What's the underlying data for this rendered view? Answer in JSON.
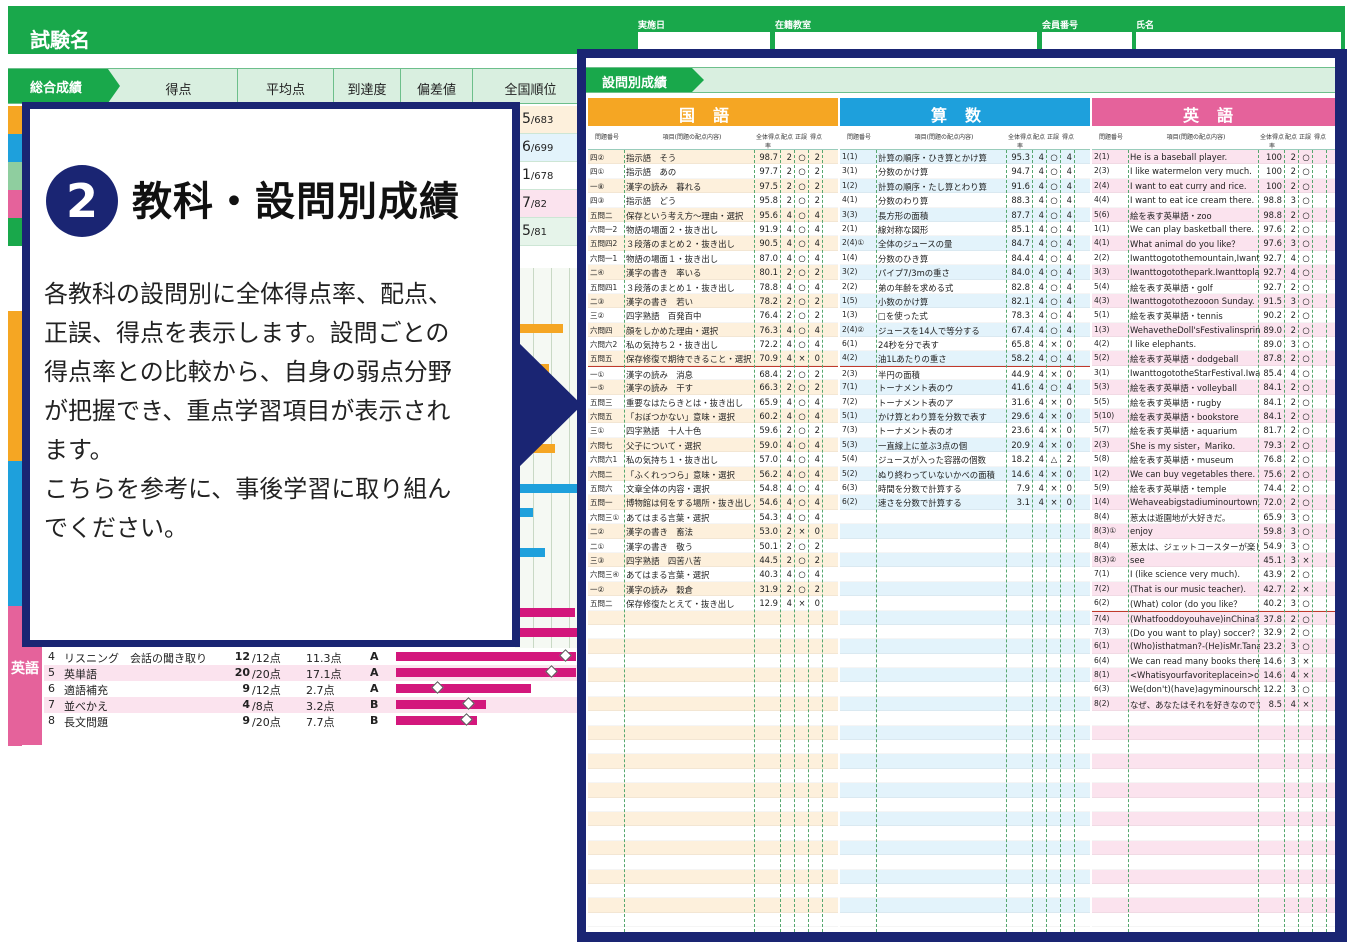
{
  "sheet": {
    "title": "試験名",
    "header_fields": [
      "実施日",
      "在籍教室",
      "会員番号",
      "氏名"
    ],
    "summary_tag": "総合成績",
    "summary_columns": [
      "得点",
      "平均点",
      "到達度",
      "偏差値",
      "全国順位"
    ],
    "ranks": [
      {
        "rank": "5",
        "total": "/683"
      },
      {
        "rank": "6",
        "total": "/699"
      },
      {
        "rank": "1",
        "total": "/678"
      },
      {
        "rank": "7",
        "total": "/82"
      },
      {
        "rank": "5",
        "total": "/81"
      }
    ],
    "english_label": "英語",
    "english_rows": [
      {
        "no": "4",
        "name": "リスニング　会話の聞き取り",
        "score": "12",
        "max": "/12点",
        "avg": "11.3点",
        "grade": "A",
        "bar": 1.0,
        "avg_frac": 0.94
      },
      {
        "no": "5",
        "name": "英単語",
        "score": "20",
        "max": "/20点",
        "avg": "17.1点",
        "grade": "A",
        "bar": 1.0,
        "avg_frac": 0.86
      },
      {
        "no": "6",
        "name": "適語補充",
        "score": "9",
        "max": "/12点",
        "avg": "2.7点",
        "grade": "A",
        "bar": 0.75,
        "avg_frac": 0.23
      },
      {
        "no": "7",
        "name": "並べかえ",
        "score": "4",
        "max": "/8点",
        "avg": "3.2点",
        "grade": "B",
        "bar": 0.5,
        "avg_frac": 0.4
      },
      {
        "no": "8",
        "name": "長文問題",
        "score": "9",
        "max": "/20点",
        "avg": "7.7点",
        "grade": "B",
        "bar": 0.45,
        "avg_frac": 0.39
      }
    ]
  },
  "popup": {
    "number": "2",
    "title": "教科・設問別成績",
    "body": [
      "各教科の設問別に全体得点率、配点、",
      "正誤、得点を表示します。設問ごとの",
      "得点率との比較から、自身の弱点分野",
      "が把握でき、重点学習項目が表示され",
      "ます。",
      "こちらを参考に、事後学習に取り組ん",
      "でください。"
    ]
  },
  "detail": {
    "tag": "設問別成績",
    "col_heads": [
      "問題番号",
      "項目(問題の配点内容)",
      "全体得点率",
      "配点",
      "正誤",
      "得点"
    ],
    "subjects": [
      {
        "name": "国語",
        "color": "#f5a623",
        "stripe": "#fdf0dc",
        "sep_after": 14,
        "rows": [
          [
            "四②",
            "指示語　そう",
            "98.7",
            "2",
            "○",
            "2"
          ],
          [
            "四①",
            "指示語　あの",
            "97.7",
            "2",
            "○",
            "2"
          ],
          [
            "一⑧",
            "漢字の読み　暮れる",
            "97.5",
            "2",
            "○",
            "2"
          ],
          [
            "四③",
            "指示語　どう",
            "95.8",
            "2",
            "○",
            "2"
          ],
          [
            "五問二",
            "保存という考え方～理由・選択",
            "95.6",
            "4",
            "○",
            "4"
          ],
          [
            "六問一2",
            "物語の場面２・抜き出し",
            "91.9",
            "4",
            "○",
            "4"
          ],
          [
            "五問四2",
            "３段落のまとめ２・抜き出し",
            "90.5",
            "4",
            "○",
            "4"
          ],
          [
            "六問一1",
            "物語の場面１・抜き出し",
            "87.0",
            "4",
            "○",
            "4"
          ],
          [
            "二④",
            "漢字の書き　率いる",
            "80.1",
            "2",
            "○",
            "2"
          ],
          [
            "五問四1",
            "３段落のまとめ１・抜き出し",
            "78.8",
            "4",
            "○",
            "4"
          ],
          [
            "二③",
            "漢字の書き　若い",
            "78.2",
            "2",
            "○",
            "2"
          ],
          [
            "三②",
            "四字熟語　百発百中",
            "76.4",
            "2",
            "○",
            "2"
          ],
          [
            "六問四",
            "顔をしかめた理由・選択",
            "76.3",
            "4",
            "○",
            "4"
          ],
          [
            "六問六2",
            "私の気持ち２・抜き出し",
            "72.2",
            "4",
            "○",
            "4"
          ],
          [
            "五問五",
            "保存修復で期待できること・選択",
            "70.9",
            "4",
            "×",
            "0"
          ],
          [
            "一①",
            "漢字の読み　消息",
            "68.4",
            "2",
            "○",
            "2"
          ],
          [
            "一⑤",
            "漢字の読み　干す",
            "66.3",
            "2",
            "○",
            "2"
          ],
          [
            "五問三",
            "重要なはたらきとは・抜き出し",
            "65.9",
            "4",
            "○",
            "4"
          ],
          [
            "六問五",
            "「おぼつかない」意味・選択",
            "60.2",
            "4",
            "○",
            "4"
          ],
          [
            "三①",
            "四字熟語　十人十色",
            "59.6",
            "2",
            "○",
            "2"
          ],
          [
            "六問七",
            "父子について・選択",
            "59.0",
            "4",
            "○",
            "4"
          ],
          [
            "六問六1",
            "私の気持ち１・抜き出し",
            "57.0",
            "4",
            "○",
            "4"
          ],
          [
            "六問二",
            "「ふくれっつら」意味・選択",
            "56.2",
            "4",
            "○",
            "4"
          ],
          [
            "五問六",
            "文章全体の内容・選択",
            "54.8",
            "4",
            "○",
            "4"
          ],
          [
            "五問一",
            "博物館は何をする場所・抜き出し",
            "54.6",
            "4",
            "○",
            "4"
          ],
          [
            "六問三①",
            "あてはまる言葉・選択",
            "54.3",
            "4",
            "○",
            "4"
          ],
          [
            "二②",
            "漢字の書き　畜法",
            "53.0",
            "2",
            "×",
            "0"
          ],
          [
            "二①",
            "漢字の書き　敬う",
            "50.1",
            "2",
            "○",
            "2"
          ],
          [
            "三③",
            "四字熟語　四苦八苦",
            "44.5",
            "2",
            "○",
            "2"
          ],
          [
            "六問三④",
            "あてはまる言葉・選択",
            "40.3",
            "4",
            "○",
            "4"
          ],
          [
            "一②",
            "漢字の読み　穀倉",
            "31.9",
            "2",
            "○",
            "2"
          ],
          [
            "五問二",
            "保存修復たとえて・抜き出し",
            "12.9",
            "4",
            "×",
            "0"
          ]
        ]
      },
      {
        "name": "算数",
        "color": "#1ea0dc",
        "stripe": "#e3f3fb",
        "sep_after": 14,
        "rows": [
          [
            "1(1)",
            "計算の順序・ひき算とかけ算",
            "95.3",
            "4",
            "○",
            "4"
          ],
          [
            "3(1)",
            "分数のかけ算",
            "94.7",
            "4",
            "○",
            "4"
          ],
          [
            "1(2)",
            "計算の順序・たし算とわり算",
            "91.6",
            "4",
            "○",
            "4"
          ],
          [
            "4(1)",
            "分数のわり算",
            "88.3",
            "4",
            "○",
            "4"
          ],
          [
            "3(3)",
            "長方形の面積",
            "87.7",
            "4",
            "○",
            "4"
          ],
          [
            "2(1)",
            "線対称な図形",
            "85.1",
            "4",
            "○",
            "4"
          ],
          [
            "2(4)①",
            "全体のジュースの量",
            "84.7",
            "4",
            "○",
            "4"
          ],
          [
            "1(4)",
            "分数のひき算",
            "84.4",
            "4",
            "○",
            "4"
          ],
          [
            "3(2)",
            "パイプ7/3mの重さ",
            "84.0",
            "4",
            "○",
            "4"
          ],
          [
            "2(2)",
            "弟の年齢を求める式",
            "82.8",
            "4",
            "○",
            "4"
          ],
          [
            "1(5)",
            "小数のかけ算",
            "82.1",
            "4",
            "○",
            "4"
          ],
          [
            "1(3)",
            "□を使った式",
            "78.3",
            "4",
            "○",
            "4"
          ],
          [
            "2(4)②",
            "ジュースを14人で等分する",
            "67.4",
            "4",
            "○",
            "4"
          ],
          [
            "6(1)",
            "24秒を分で表す",
            "65.8",
            "4",
            "×",
            "0"
          ],
          [
            "4(2)",
            "油1Lあたりの重さ",
            "58.2",
            "4",
            "○",
            "4"
          ],
          [
            "2(3)",
            "半円の面積",
            "44.9",
            "4",
            "×",
            "0"
          ],
          [
            "7(1)",
            "トーナメント表のウ",
            "41.6",
            "4",
            "○",
            "4"
          ],
          [
            "7(2)",
            "トーナメント表のア",
            "31.6",
            "4",
            "×",
            "0"
          ],
          [
            "5(1)",
            "かけ算とわり算を分数で表す",
            "29.6",
            "4",
            "×",
            "0"
          ],
          [
            "7(3)",
            "トーナメント表のオ",
            "23.6",
            "4",
            "×",
            "0"
          ],
          [
            "5(3)",
            "一直線上に並ぶ3点の個",
            "20.9",
            "4",
            "×",
            "0"
          ],
          [
            "5(4)",
            "ジュースが入った容器の個数",
            "18.2",
            "4",
            "△",
            "2"
          ],
          [
            "5(2)",
            "ぬり終わっていないかべの面積",
            "14.6",
            "4",
            "×",
            "0"
          ],
          [
            "6(3)",
            "時間を分数で計算する",
            "7.9",
            "4",
            "×",
            "0"
          ],
          [
            "6(2)",
            "速さを分数で計算する",
            "3.1",
            "4",
            "×",
            "0"
          ]
        ]
      },
      {
        "name": "英語",
        "color": "#e5629b",
        "stripe": "#fbe3ee",
        "sep_after": 31,
        "rows": [
          [
            "2(1)",
            "He is a baseball player.",
            "100",
            "2",
            "○",
            ""
          ],
          [
            "2(3)",
            "I like watermelon very much.",
            "100",
            "2",
            "○",
            ""
          ],
          [
            "2(4)",
            "I want to eat curry and rice.",
            "100",
            "2",
            "○",
            ""
          ],
          [
            "4(4)",
            "I want to eat ice cream there.",
            "98.8",
            "3",
            "○",
            ""
          ],
          [
            "5(6)",
            "絵を表す英単語・zoo",
            "98.8",
            "2",
            "○",
            ""
          ],
          [
            "1(1)",
            "We can play basketball there.",
            "97.6",
            "2",
            "○",
            ""
          ],
          [
            "4(1)",
            "What animal do you like？",
            "97.6",
            "3",
            "○",
            ""
          ],
          [
            "2(2)",
            "Iwanttogotothemountain,Iwanttoenjoycamping.",
            "92.7",
            "4",
            "○",
            ""
          ],
          [
            "3(3)",
            "Iwanttogotothepark.Iwanttoplaybadminton.",
            "92.7",
            "4",
            "○",
            ""
          ],
          [
            "5(4)",
            "絵を表す英単語・golf",
            "92.7",
            "2",
            "○",
            ""
          ],
          [
            "4(3)",
            "Iwanttogotothezooon Sunday.",
            "91.5",
            "3",
            "○",
            ""
          ],
          [
            "5(1)",
            "絵を表す英単語・tennis",
            "90.2",
            "2",
            "○",
            ""
          ],
          [
            "1(3)",
            "WehavetheDoll'sFestivalinspring.",
            "89.0",
            "2",
            "○",
            ""
          ],
          [
            "4(2)",
            "I like elephants.",
            "89.0",
            "3",
            "○",
            ""
          ],
          [
            "5(2)",
            "絵を表す英単語・dodgeball",
            "87.8",
            "2",
            "○",
            ""
          ],
          [
            "3(1)",
            "IwanttogototheStarFestival.IwanttoseetheMilkyWay.",
            "85.4",
            "4",
            "○",
            ""
          ],
          [
            "5(3)",
            "絵を表す英単語・volleyball",
            "84.1",
            "2",
            "○",
            ""
          ],
          [
            "5(5)",
            "絵を表す英単語・rugby",
            "84.1",
            "2",
            "○",
            ""
          ],
          [
            "5(10)",
            "絵を表す英単語・bookstore",
            "84.1",
            "2",
            "○",
            ""
          ],
          [
            "5(7)",
            "絵を表す英単語・aquarium",
            "81.7",
            "2",
            "○",
            ""
          ],
          [
            "2(3)",
            "She is my sister，Mariko.",
            "79.3",
            "2",
            "○",
            ""
          ],
          [
            "5(8)",
            "絵を表す英単語・museum",
            "76.8",
            "2",
            "○",
            ""
          ],
          [
            "1(2)",
            "We can buy vegetables there.",
            "75.6",
            "2",
            "○",
            ""
          ],
          [
            "5(9)",
            "絵を表す英単語・temple",
            "74.4",
            "2",
            "○",
            ""
          ],
          [
            "1(4)",
            "Wehaveabigstadiuminourtown.",
            "72.0",
            "2",
            "○",
            ""
          ],
          [
            "8(4)",
            "葱太は遊園地が大好きだ。",
            "65.9",
            "3",
            "○",
            ""
          ],
          [
            "8(3)①",
            "enjoy",
            "59.8",
            "3",
            "○",
            ""
          ],
          [
            "8(4)",
            "葱太は、ジェットコースターが楽しい。",
            "54.9",
            "3",
            "○",
            ""
          ],
          [
            "8(3)②",
            "see",
            "45.1",
            "3",
            "×",
            ""
          ],
          [
            "7(1)",
            "I (like science very much).",
            "43.9",
            "2",
            "○",
            ""
          ],
          [
            "7(2)",
            "(That is our music teacher).",
            "42.7",
            "2",
            "×",
            ""
          ],
          [
            "6(2)",
            "(What) color (do you like？",
            "40.2",
            "3",
            "○",
            ""
          ],
          [
            "7(4)",
            "(Whatfooddoyouhave)inChina?",
            "37.8",
            "2",
            "○",
            ""
          ],
          [
            "7(3)",
            "(Do you want to play) soccer？",
            "32.9",
            "2",
            "○",
            ""
          ],
          [
            "6(1)",
            "(Who)isthatman?-(He)isMr.Tanaka.",
            "23.2",
            "3",
            "○",
            ""
          ],
          [
            "6(4)",
            "We can read many books there.",
            "14.6",
            "3",
            "×",
            ""
          ],
          [
            "8(1)",
            "<Whatisyourfavoriteplacein>ourtown?",
            "14.6",
            "4",
            "×",
            ""
          ],
          [
            "6(3)",
            "We(don't)(have)agyminourschool.",
            "12.2",
            "3",
            "○",
            ""
          ],
          [
            "8(2)",
            "なぜ、あなたはそれを好きなのですか。",
            "8.5",
            "4",
            "×",
            ""
          ]
        ]
      }
    ]
  },
  "colors": {
    "green": "#19a84b",
    "navy": "#1a2573",
    "kokugo": "#f5a623",
    "sansu": "#1ea0dc",
    "eigo": "#e5629b",
    "error_line": "#c0392b"
  }
}
